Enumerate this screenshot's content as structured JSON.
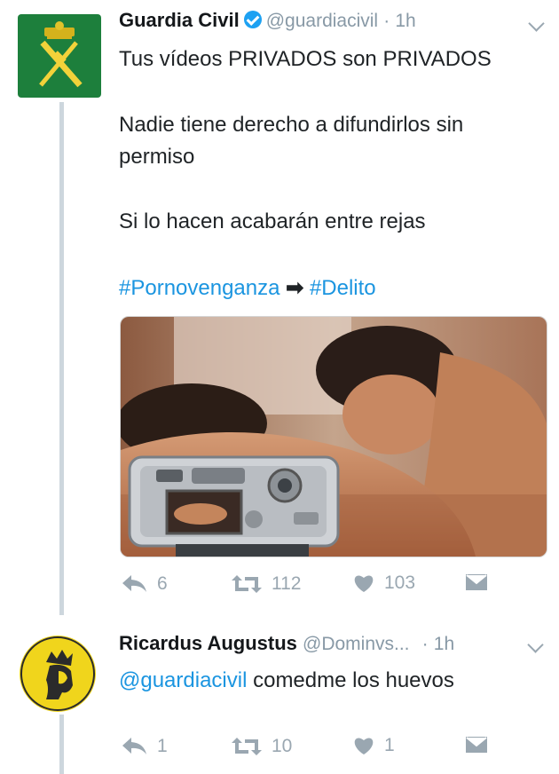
{
  "tweet1": {
    "name": "Guardia Civil",
    "handle": "@guardiacivil",
    "dot": "·",
    "time": "1h",
    "lines": [
      "Tus vídeos PRIVADOS son PRIVADOS",
      "Nadie tiene derecho a difundirlos sin",
      "permiso",
      "Si lo hacen acabarán entre rejas"
    ],
    "hashtag1": "#Pornovenganza",
    "arrow": "➡",
    "hashtag2": "#Delito",
    "actions": {
      "replies": "6",
      "retweets": "112",
      "likes": "103"
    }
  },
  "tweet2": {
    "name": "Ricardus Augustus",
    "handle": "@Dominvs...",
    "dot": "·",
    "time": "1h",
    "mention": "@guardiacivil",
    "text": " comedme los huevos",
    "actions": {
      "replies": "1",
      "retweets": "10",
      "likes": "1"
    }
  },
  "colors": {
    "link": "#1b95e0",
    "verified": "#1da1f2",
    "muted": "#8899a6",
    "avatar_green": "#1d7f3c",
    "avatar_yellow": "#f0d51c"
  },
  "icons": [
    "verified-badge-icon",
    "chevron-down-icon",
    "reply-icon",
    "retweet-icon",
    "heart-icon",
    "direct-message-icon"
  ]
}
